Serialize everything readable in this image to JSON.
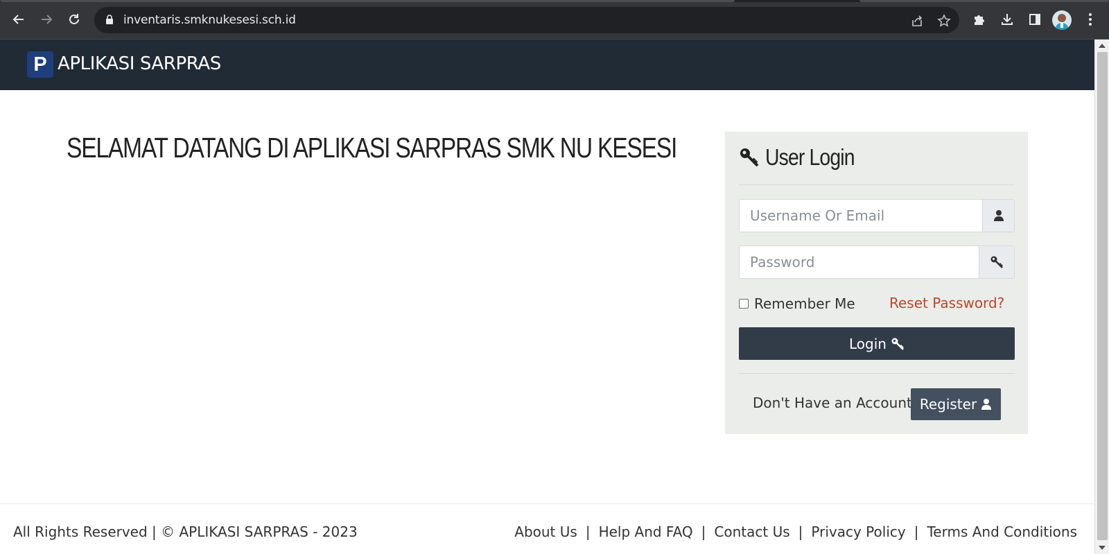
{
  "browser": {
    "url": "inventaris.smknukesesi.sch.id"
  },
  "navbar": {
    "logo_letter": "P",
    "brand": "APLIKASI SARPRAS"
  },
  "main": {
    "welcome_heading": "SELAMAT DATANG DI APLIKASI SARPRAS SMK NU KESESI"
  },
  "login": {
    "title": "User Login",
    "username_placeholder": "Username Or Email",
    "username_value": "",
    "password_placeholder": "Password",
    "password_value": "",
    "remember_label": "Remember Me",
    "remember_checked": false,
    "reset_link": "Reset Password?",
    "login_button": "Login",
    "no_account_text": "Don't Have an Account?",
    "register_button": "Register"
  },
  "footer": {
    "copyright": "All Rights Reserved | © APLIKASI SARPRAS - 2023",
    "links": [
      "About Us",
      "Help And FAQ",
      "Contact Us",
      "Privacy Policy",
      "Terms And Conditions"
    ]
  },
  "colors": {
    "navbar_bg": "#212b36",
    "logo_bg": "#1f3e7d",
    "login_button_bg": "#323c49",
    "register_button_bg": "#44505f",
    "reset_link": "#c0442b",
    "card_bg": "#ebedea"
  },
  "icons": {
    "username_addon": "user-icon",
    "password_addon": "key-icon",
    "title": "key-icon",
    "login_button": "key-icon",
    "register_button": "user-icon"
  }
}
